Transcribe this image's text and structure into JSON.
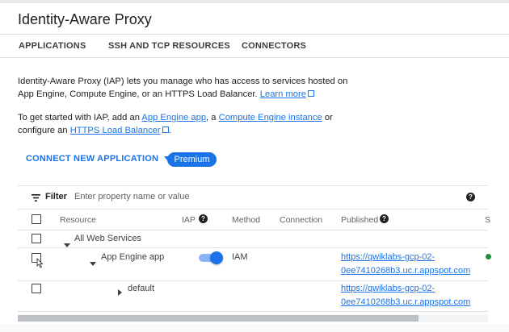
{
  "header": {
    "title": "Identity-Aware Proxy"
  },
  "tabs": [
    {
      "label": "APPLICATIONS"
    },
    {
      "label": "SSH AND TCP RESOURCES"
    },
    {
      "label": "CONNECTORS"
    }
  ],
  "intro": {
    "p1_text": "Identity-Aware Proxy (IAP) lets you manage who has access to services hosted on App Engine, Compute Engine, or an HTTPS Load Balancer.",
    "p1_link": "Learn more",
    "p2_a": "To get started with IAP, add an",
    "p2_link1": "App Engine app",
    "p2_b": ", a",
    "p2_link2": "Compute Engine instance",
    "p2_c": "or configure an",
    "p2_link3": "HTTPS Load Balancer",
    "p2_d": "."
  },
  "actions": {
    "connect_label": "CONNECT NEW APPLICATION",
    "premium_label": "Premium"
  },
  "filter": {
    "label": "Filter",
    "placeholder": "Enter property name or value",
    "help_icon": "help-icon"
  },
  "table": {
    "headers": {
      "resource": "Resource",
      "iap": "IAP",
      "method": "Method",
      "connection": "Connection",
      "published": "Published",
      "status_partial": "S"
    },
    "rows": [
      {
        "resource": "All Web Services"
      },
      {
        "resource": "App Engine app",
        "iap_enabled": true,
        "method": "IAM",
        "published_1": "https://qwiklabs-gcp-02-",
        "published_2": "0ee7410268b3.uc.r.appspot.com",
        "status_color": "#1e8e3e"
      },
      {
        "resource": "default",
        "published_1": "https://qwiklabs-gcp-02-",
        "published_2": "0ee7410268b3.uc.r.appspot.com"
      }
    ]
  },
  "colors": {
    "accent": "#1a73e8",
    "text": "#202124",
    "status_ok": "#1e8e3e"
  }
}
